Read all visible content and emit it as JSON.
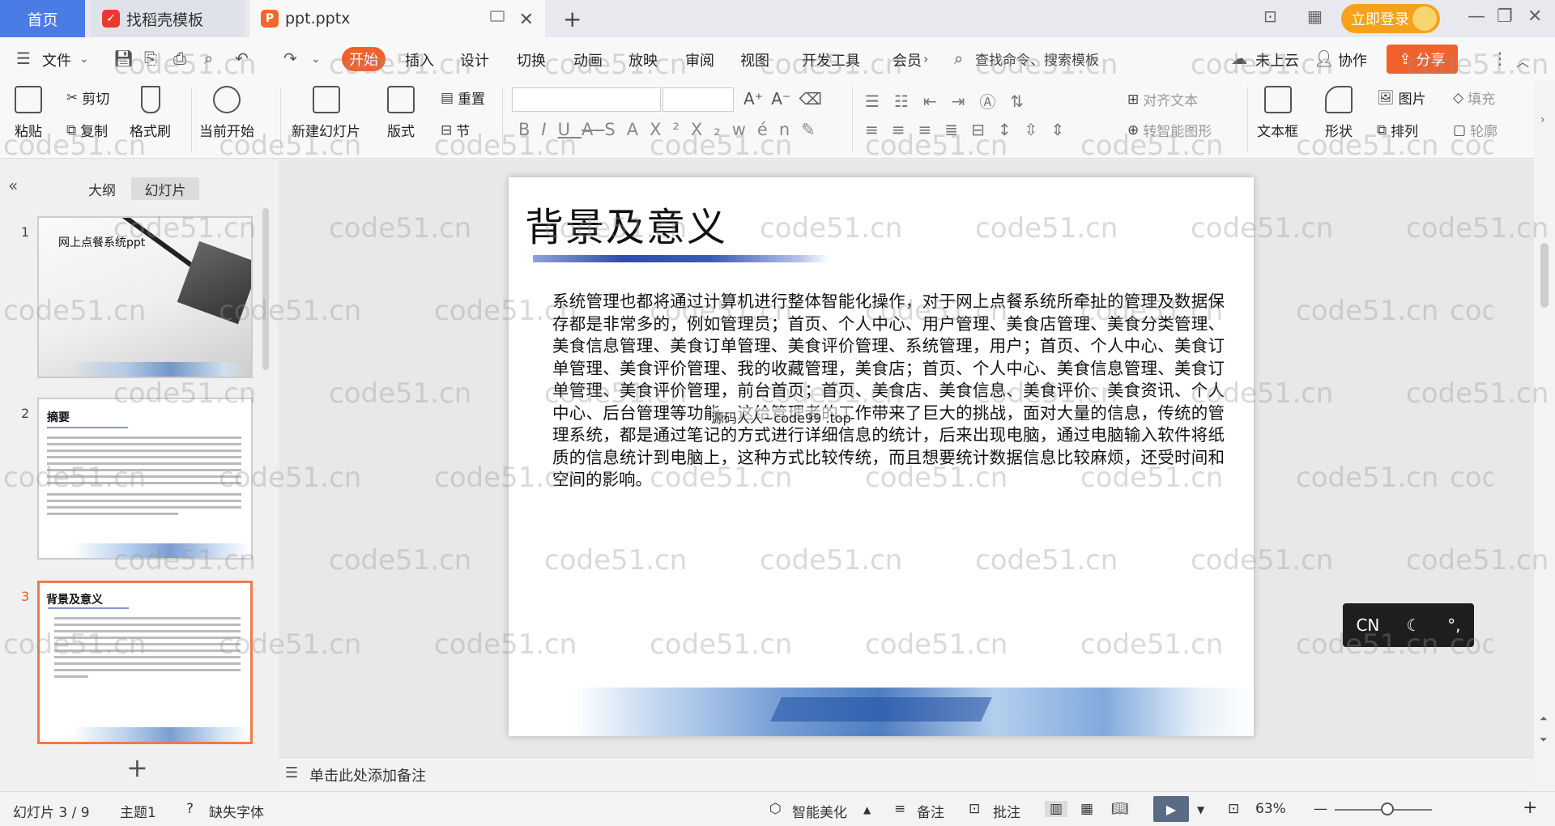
{
  "titlebar": {
    "home_tab": "首页",
    "templates_tab": "找稻壳模板",
    "doc_tab": "ppt.pptx",
    "login_button": "立即登录"
  },
  "menubar": {
    "file": "文件",
    "items": [
      "开始",
      "插入",
      "设计",
      "切换",
      "动画",
      "放映",
      "审阅",
      "视图",
      "开发工具",
      "会员"
    ],
    "search_placeholder": "查找命令、搜索模板",
    "cloud": "未上云",
    "collab": "协作",
    "share": "分享"
  },
  "ribbon": {
    "paste": "粘贴",
    "cut": "剪切",
    "copy": "复制",
    "format_painter": "格式刷",
    "from_current": "当前开始",
    "new_slide": "新建幻灯片",
    "layout": "版式",
    "reset": "重置",
    "section": "节",
    "align_text": "对齐文本",
    "smartart": "转智能图形",
    "textbox": "文本框",
    "shape": "形状",
    "picture": "图片",
    "fill": "填充",
    "arrange": "排列",
    "outline": "轮廓"
  },
  "leftpanel": {
    "tab_outline": "大纲",
    "tab_slides": "幻灯片",
    "thumbs": [
      {
        "num": "1",
        "title": "网上点餐系统ppt"
      },
      {
        "num": "2",
        "title": "摘要"
      },
      {
        "num": "3",
        "title": "背景及意义"
      }
    ]
  },
  "slide": {
    "title": "背景及意义",
    "body": "系统管理也都将通过计算机进行整体智能化操作，对于网上点餐系统所牵扯的管理及数据保存都是非常多的，例如管理员；首页、个人中心、用户管理、美食店管理、美食分类管理、美食信息管理、美食订单管理、美食评价管理、系统管理，用户；首页、个人中心、美食订单管理、美食评价管理、我的收藏管理，美食店；首页、个人中心、美食信息管理、美食订单管理、美食评价管理，前台首页；首页、美食店、美食信息、美食评价、美食资讯、个人中心、后台管理等功能，这给管理者的工作带来了巨大的挑战，面对大量的信息，传统的管理系统，都是通过笔记的方式进行详细信息的统计，后来出现电脑，通过电脑输入软件将纸质的信息统计到电脑上，这种方式比较传统，而且想要统计数据信息比较麻烦，还受时间和空间的影响。",
    "overlay_text": "源码人人~code99 .top"
  },
  "ime": {
    "lang": "CN"
  },
  "notes": {
    "placeholder": "单击此处添加备注"
  },
  "statusbar": {
    "slide_count": "幻灯片 3 / 9",
    "theme": "主题1",
    "missing_font": "缺失字体",
    "beautify": "智能美化",
    "notes": "备注",
    "comment": "批注",
    "zoom": "63%"
  },
  "watermark": "code51.cn"
}
